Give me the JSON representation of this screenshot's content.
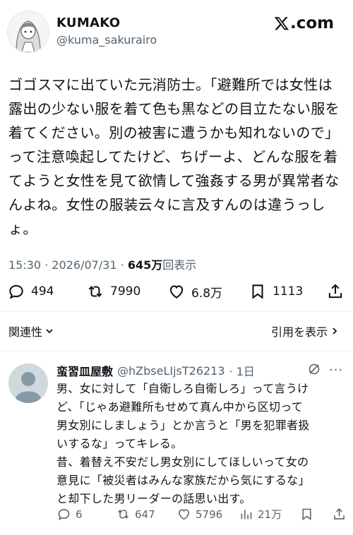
{
  "tweet": {
    "display_name": "KUMAKO",
    "handle": "@kuma_sakurairo",
    "site": ".com",
    "lines": [
      "ゴゴスマに出ていた元消防士。「避難所では女性は",
      "露出の少ない服を着て色も黒などの目立たない服を",
      "着てください。別の被害に遭うかも知れないので」",
      "って注意喚起してたけど、ちげーよ、どんな服を着",
      "てようと女性を見て欲情して強姦する男が異常者な",
      "んよね。女性の服装云々に言及すんのは違うっし",
      "ょ。"
    ],
    "timestamp": "15:30 · 2026/07/31 · ",
    "views_count": "645万",
    "views_label": "回表示",
    "replies": "494",
    "retweets": "7990",
    "likes": "6.8万",
    "bookmarks": "1113"
  },
  "nav": {
    "related_label": "関連性",
    "quotes_label": "引用を表示"
  },
  "reply": {
    "display_name": "蛮習皿屋敷",
    "handle": "@hZbseLIjsT26213",
    "time": "· 1日",
    "more": "···",
    "lines": [
      "男、女に対して「自衛しろ自衛しろ」って言うけ",
      "ど、「じゃあ避難所もせめて真ん中から区切って",
      "男女別にしましょう」とか言うと「男を犯罪者扱",
      "いするな」ってキレる。",
      "昔、着替え不安だし男女別にしてほしいって女の",
      "意見に「被災者はみんな家族だから気にするな」",
      "と却下した男リーダーの話思い出す。"
    ],
    "replies": "6",
    "retweets": "647",
    "likes": "5796",
    "views": "21万"
  }
}
